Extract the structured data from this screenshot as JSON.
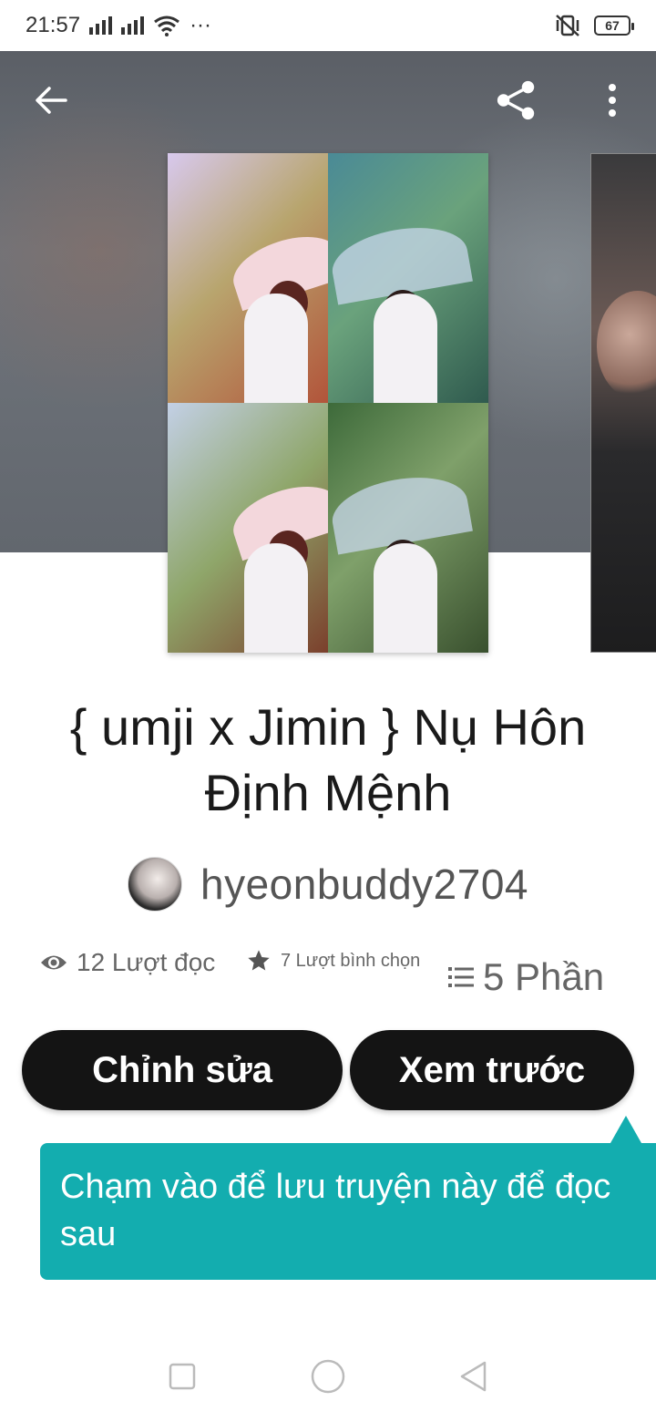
{
  "status_bar": {
    "time": "21:57",
    "signal_icon": "signal-bars",
    "wifi_icon": "wifi-icon",
    "more_dots": "···",
    "vibrate_icon": "vibrate-mute-icon",
    "battery": "67"
  },
  "header": {
    "back_icon": "arrow-left-icon",
    "share_icon": "share-icon",
    "more_icon": "more-vertical-icon"
  },
  "story": {
    "title": "{ umji x Jimin } Nụ Hôn Định Mệnh",
    "author": "hyeonbuddy2704",
    "reads": "12 Lượt đọc",
    "votes": "7 Lượt bình chọn",
    "parts": "5 Phần"
  },
  "actions": {
    "edit_label": "Chỉnh sửa",
    "preview_label": "Xem trước"
  },
  "tooltip": {
    "text": "Chạm vào để lưu truyện này để đọc sau"
  },
  "colors": {
    "accent": "#13adaf",
    "button": "#141414",
    "text": "#1a1a1a"
  },
  "nav_bar": {
    "recents_icon": "square-icon",
    "home_icon": "circle-icon",
    "back_icon": "triangle-back-icon"
  }
}
